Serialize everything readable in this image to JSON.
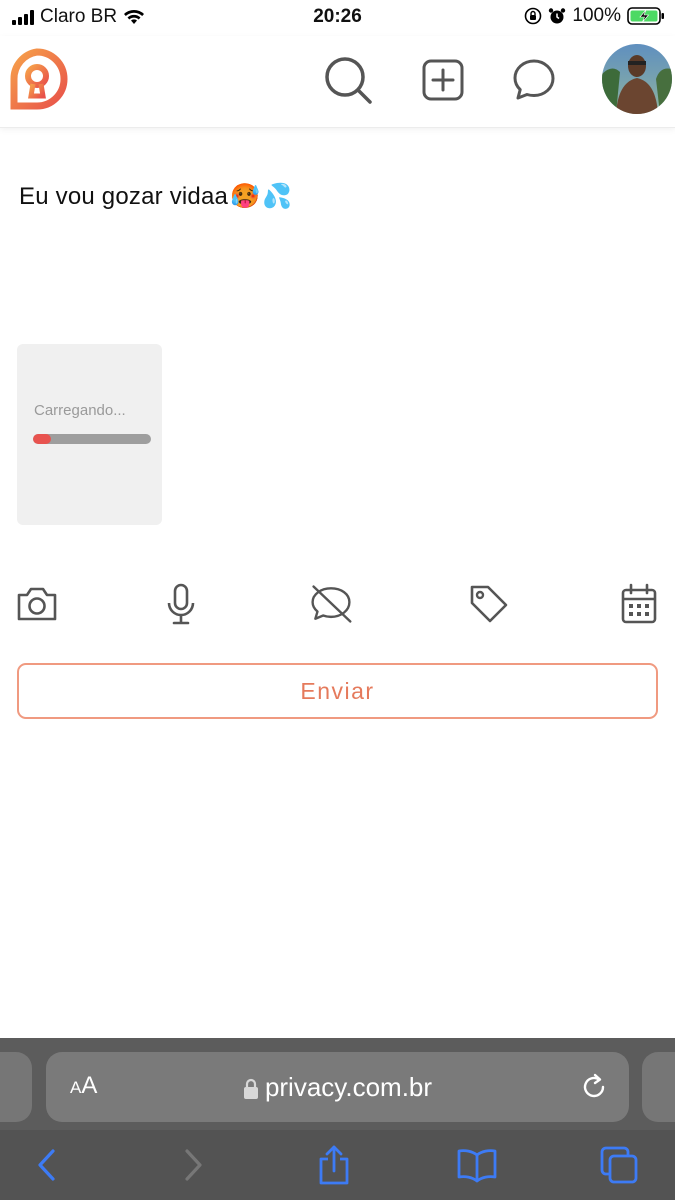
{
  "status_bar": {
    "carrier": "Claro BR",
    "time": "20:26",
    "battery": "100%",
    "icons": [
      "signal-icon",
      "wifi-icon",
      "orientation-lock-icon",
      "alarm-icon",
      "battery-charging-icon"
    ]
  },
  "header": {
    "logo": "privacy-logo-icon",
    "icons": [
      "search-icon",
      "add-post-icon",
      "messages-icon"
    ],
    "avatar": "profile-avatar"
  },
  "post": {
    "text": "Eu vou gozar vidaa",
    "emojis": [
      "🥵",
      "💦"
    ]
  },
  "media": {
    "loading_label": "Carregando...",
    "progress": 0.15,
    "progress_color": "#e8534f"
  },
  "toolbar": {
    "icons": [
      "camera-icon",
      "microphone-icon",
      "hide-comments-icon",
      "tag-icon",
      "calendar-icon"
    ]
  },
  "send_button": {
    "label": "Enviar",
    "color": "#e57a5c"
  },
  "browser": {
    "aa_label_small": "A",
    "aa_label_large": "A",
    "url": "privacy.com.br",
    "nav_icons": [
      "back-icon",
      "forward-icon",
      "share-icon",
      "bookmarks-icon",
      "tabs-icon"
    ]
  }
}
